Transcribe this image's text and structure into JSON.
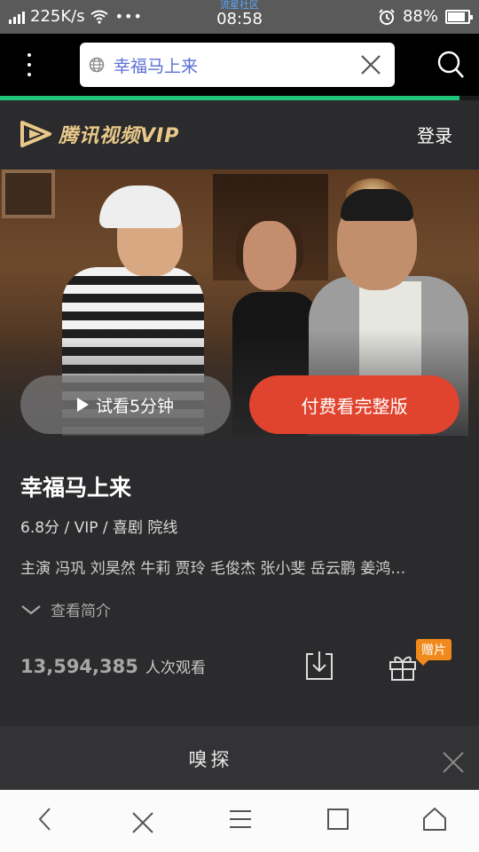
{
  "status_bar": {
    "net_speed": "225K/s",
    "carrier": "流星社区",
    "time": "08:58",
    "battery": "88%",
    "battery_level": 0.88
  },
  "browser": {
    "url_text": "幸福马上来",
    "load_progress": 0.96
  },
  "header": {
    "brand": "腾讯视频VIP",
    "login_label": "登录"
  },
  "player": {
    "trial_label": "试看5分钟",
    "pay_label": "付费看完整版"
  },
  "movie": {
    "title": "幸福马上来",
    "meta": "6.8分 / VIP / 喜剧 院线",
    "cast": "主演 冯巩 刘昊然 牛莉 贾玲 毛俊杰 张小斐 岳云鹏 姜鸿…",
    "expand_label": "查看简介",
    "views_count": "13,594,385",
    "views_label": "人次观看",
    "gift_badge": "赠片"
  },
  "suggestion": {
    "text": "嗅探"
  },
  "colors": {
    "accent_red": "#e0432e",
    "vip_gold": "#e9c98a",
    "progress_green": "#21c27a",
    "badge_orange": "#f08a1c"
  }
}
